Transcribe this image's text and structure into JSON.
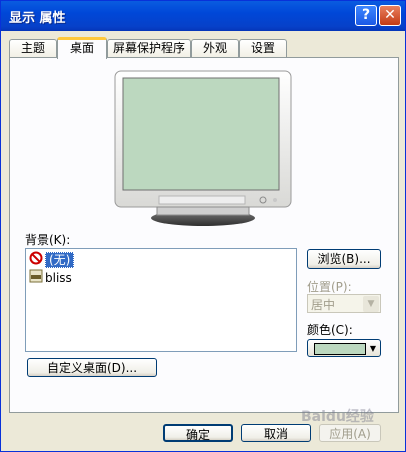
{
  "window": {
    "title": "显示 属性",
    "help_glyph": "?",
    "close_glyph": "✕"
  },
  "tabs": [
    {
      "label": "主题"
    },
    {
      "label": "桌面"
    },
    {
      "label": "屏幕保护程序"
    },
    {
      "label": "外观"
    },
    {
      "label": "设置"
    }
  ],
  "background": {
    "label": "背景(K):",
    "items": [
      {
        "label": "(无)",
        "icon": "none-icon",
        "selected": true
      },
      {
        "label": "bliss",
        "icon": "jpeg-file-icon",
        "selected": false
      }
    ]
  },
  "browse_button": "浏览(B)...",
  "position": {
    "label": "位置(P):",
    "value": "居中"
  },
  "color": {
    "label": "颜色(C):",
    "value": "#bcd8bf"
  },
  "customize_button": "自定义桌面(D)...",
  "footer": {
    "ok": "确定",
    "cancel": "取消",
    "apply": "应用(A)"
  },
  "watermark": "Baidu经验",
  "colors": {
    "title_bar": "#0047d8",
    "preview_screen": "#bcd8bf",
    "selection": "#316ac5"
  }
}
